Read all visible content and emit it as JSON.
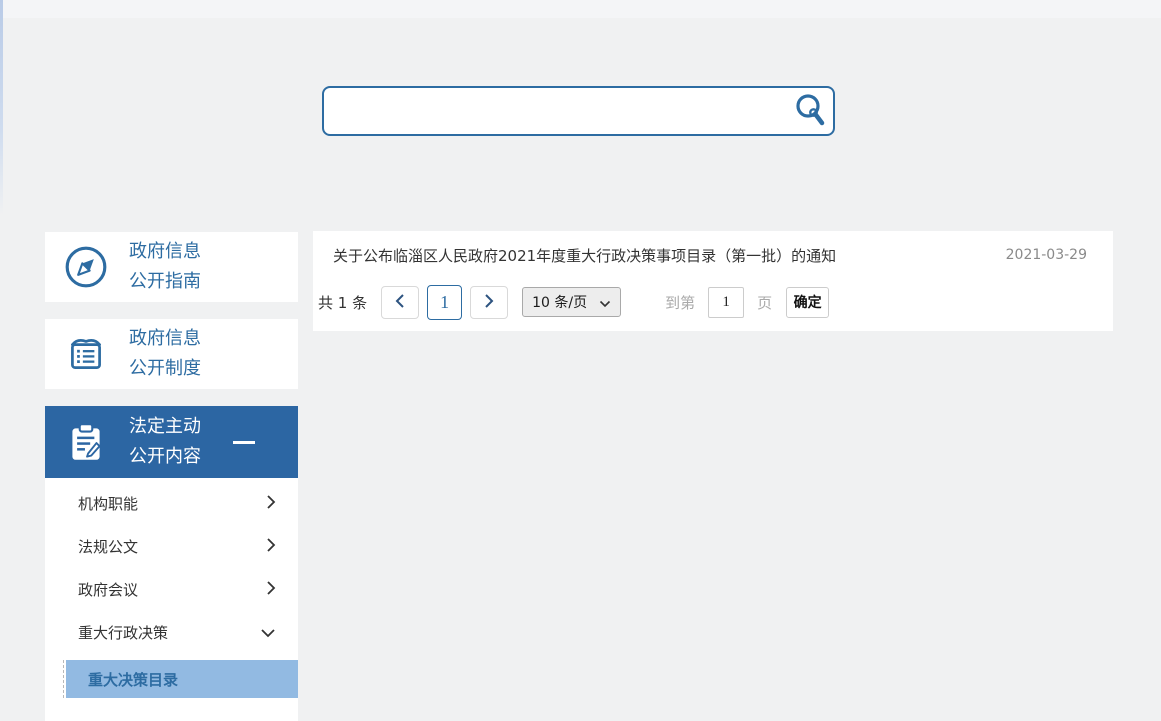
{
  "colors": {
    "accent_blue": "#2d6ca2",
    "sidebar_active_bg": "#2c66a3",
    "subsub_highlight_bg": "#92bae2",
    "page_bg": "#f0f1f2",
    "date_gray": "#8a8a8a"
  },
  "search": {
    "value": "",
    "placeholder": "",
    "icon": "magnifier-icon"
  },
  "sidebar": {
    "items": [
      {
        "line1": "政府信息",
        "line2": "公开指南",
        "icon": "compass-icon",
        "active": false
      },
      {
        "line1": "政府信息",
        "line2": "公开制度",
        "icon": "document-lines-icon",
        "active": false
      },
      {
        "line1": "法定主动",
        "line2": "公开内容",
        "icon": "clipboard-pencil-icon",
        "active": true,
        "expanded": true
      }
    ],
    "submenu": [
      {
        "label": "机构职能",
        "state": "collapsed"
      },
      {
        "label": "法规公文",
        "state": "collapsed"
      },
      {
        "label": "政府会议",
        "state": "collapsed"
      },
      {
        "label": "重大行政决策",
        "state": "expanded"
      }
    ],
    "subsubmenu": [
      {
        "label": "重大决策目录",
        "active": true
      }
    ]
  },
  "content": {
    "list": [
      {
        "title": "关于公布临淄区人民政府2021年度重大行政决策事项目录（第一批）的通知",
        "date": "2021-03-29"
      }
    ],
    "pagination": {
      "total_text": "共 1 条",
      "current_page": "1",
      "page_size_label": "10 条/页",
      "goto_prefix": "到第",
      "goto_value": "1",
      "goto_suffix": "页",
      "confirm_label": "确定"
    }
  }
}
